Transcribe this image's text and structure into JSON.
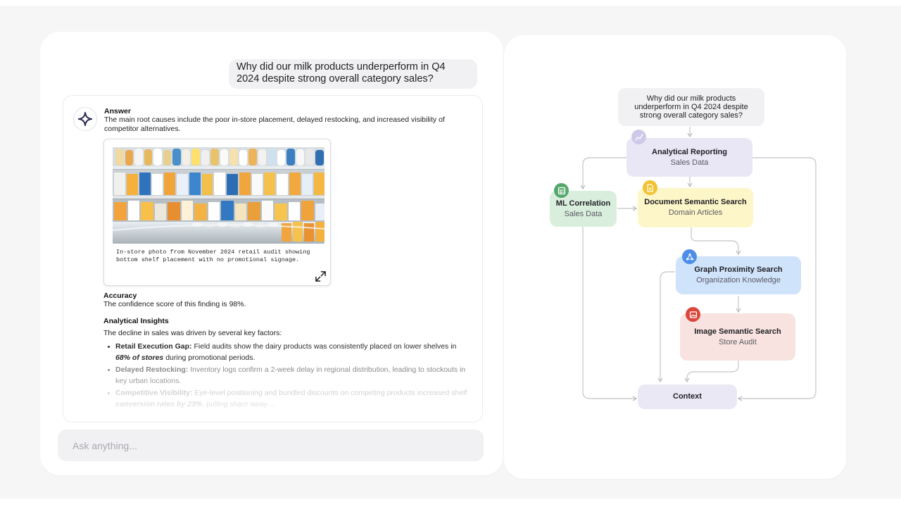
{
  "chat": {
    "question": "Why did our milk products underperform in Q4 2024 despite strong overall category sales?",
    "answer": {
      "heading": "Answer",
      "text": "The main root causes include the  poor in-store placement, delayed restocking, and increased visibility of competitor alternatives.",
      "image_caption": "In-store photo from November 2024 retail audit showing bottom shelf placement with no promotional signage."
    },
    "accuracy": {
      "heading": "Accuracy",
      "text": "The confidence score of this finding is 98%."
    },
    "insights": {
      "heading": "Analytical Insights",
      "intro": "The decline in sales was driven by several key factors:",
      "items": [
        {
          "label": "Retail Execution Gap:",
          "text": " Field audits show the dairy products was consistently placed on lower shelves in ",
          "emphasis": "68% of stores",
          "tail": " during promotional periods."
        },
        {
          "label": "Delayed Restocking:",
          "text": " Inventory logs confirm a 2-week delay in regional distribution, leading to stockouts in key urban locations.",
          "emphasis": "",
          "tail": ""
        },
        {
          "label": "Competitive Visibility:",
          "text": " Eye-level positioning and bundled discounts on competing products increased shelf ",
          "emphasis": "conversion rates by 23%",
          "tail": ", pulling share away...."
        }
      ]
    },
    "input_placeholder": "Ask anything..."
  },
  "flow": {
    "question": "Why did our milk products underperform in Q4 2024 despite strong overall category sales?",
    "nodes": {
      "analytical": {
        "title": "Analytical Reporting",
        "subtitle": "Sales Data",
        "icon": "chart-icon",
        "color": "#e9e6f6",
        "badge": "#cfc8e8"
      },
      "ml": {
        "title": "ML Correlation",
        "subtitle": "Sales Data",
        "icon": "table-icon",
        "color": "#d9eedd",
        "badge": "#55a86b"
      },
      "document": {
        "title": "Document Semantic Search",
        "subtitle": "Domain Articles",
        "icon": "document-icon",
        "color": "#fdf6c8",
        "badge": "#f2c230"
      },
      "graph": {
        "title": "Graph Proximity Search",
        "subtitle": "Organization Knowledge",
        "icon": "graph-icon",
        "color": "#cfe3fb",
        "badge": "#4d8ee8"
      },
      "image": {
        "title": "Image Semantic Search",
        "subtitle": "Store Audit",
        "icon": "image-icon",
        "color": "#f9e3e1",
        "badge": "#d9483b"
      },
      "context": {
        "title": "Context",
        "subtitle": "",
        "color": "#ebe8f6"
      }
    }
  }
}
